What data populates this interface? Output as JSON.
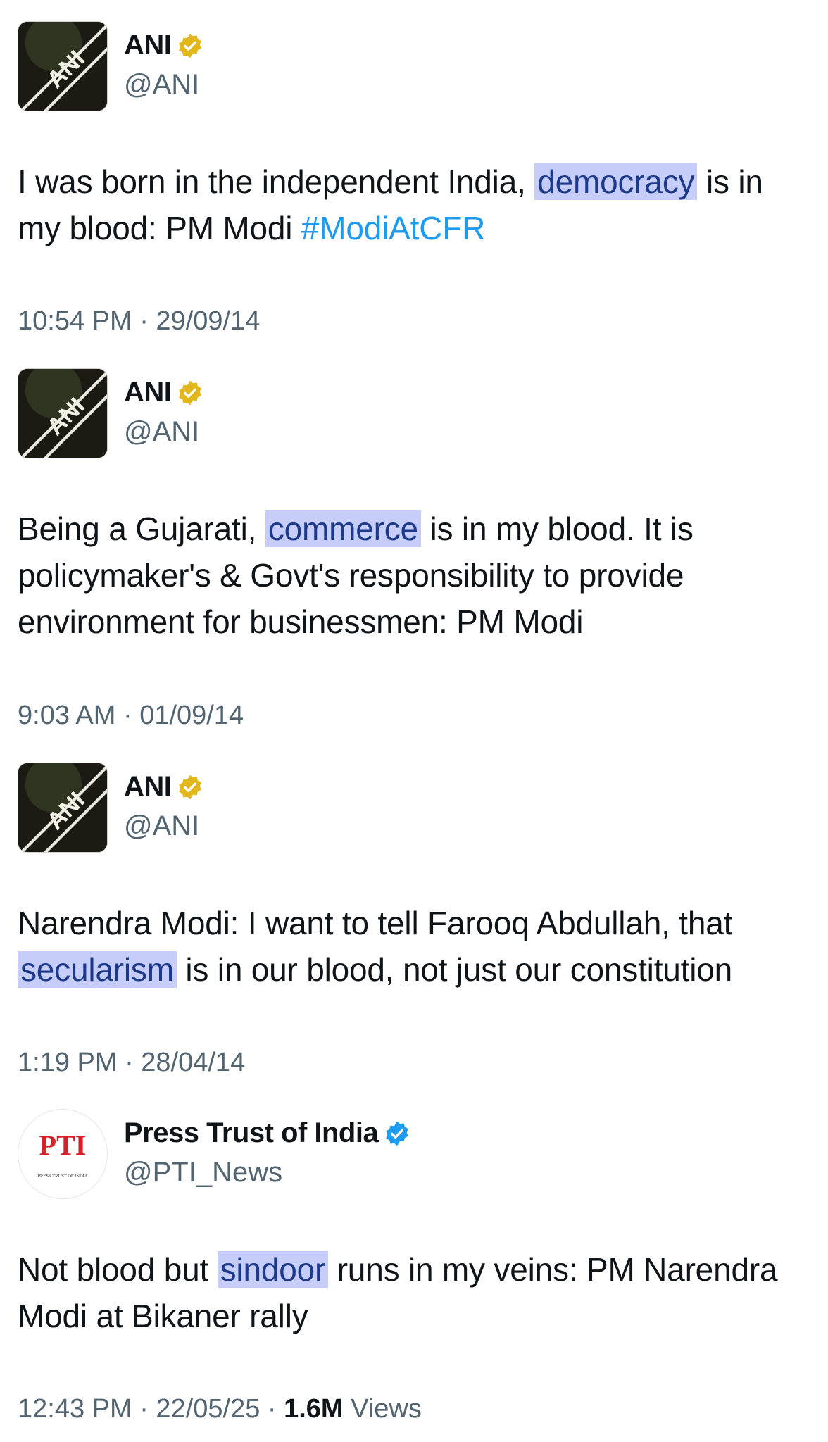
{
  "tweets": [
    {
      "author": "ANI",
      "handle": "@ANI",
      "avatar_text": "ANI",
      "text_before": "I was born in the independent India, ",
      "highlight": "democracy",
      "text_after": " is in my blood: PM Modi ",
      "hashtag": "#ModiAtCFR",
      "timestamp": "10:54 PM · 29/09/14"
    },
    {
      "author": "ANI",
      "handle": "@ANI",
      "avatar_text": "ANI",
      "text_before": "Being a Gujarati, ",
      "highlight": "commerce",
      "text_after": " is in my blood. It is policymaker's & Govt's responsibility to provide environment for businessmen: PM Modi",
      "timestamp": "9:03 AM · 01/09/14"
    },
    {
      "author": "ANI",
      "handle": "@ANI",
      "avatar_text": "ANI",
      "text_before": "Narendra Modi: I want to tell Farooq Abdullah, that ",
      "highlight": "secularism",
      "text_after": " is in our blood, not just our constitution",
      "timestamp": "1:19 PM · 28/04/14"
    },
    {
      "author": "Press Trust of India",
      "handle": "@PTI_News",
      "avatar_text": "PTI",
      "avatar_subtext": "PRESS TRUST OF INDIA",
      "text_before": "Not blood but ",
      "highlight": "sindoor",
      "text_after": " runs in my veins: PM Narendra Modi at Bikaner rally",
      "timestamp": "12:43 PM · 22/05/25 · ",
      "views_count": "1.6M",
      "views_label": " Views"
    }
  ],
  "colors": {
    "verified_gold": "#e2b719",
    "verified_blue": "#1d9bf0",
    "highlight_bg": "#c6cdf9",
    "hashtag": "#1d9bf0",
    "pti_red": "#d8202a"
  },
  "icons": [
    "verified-gold-badge-icon",
    "verified-blue-badge-icon"
  ]
}
